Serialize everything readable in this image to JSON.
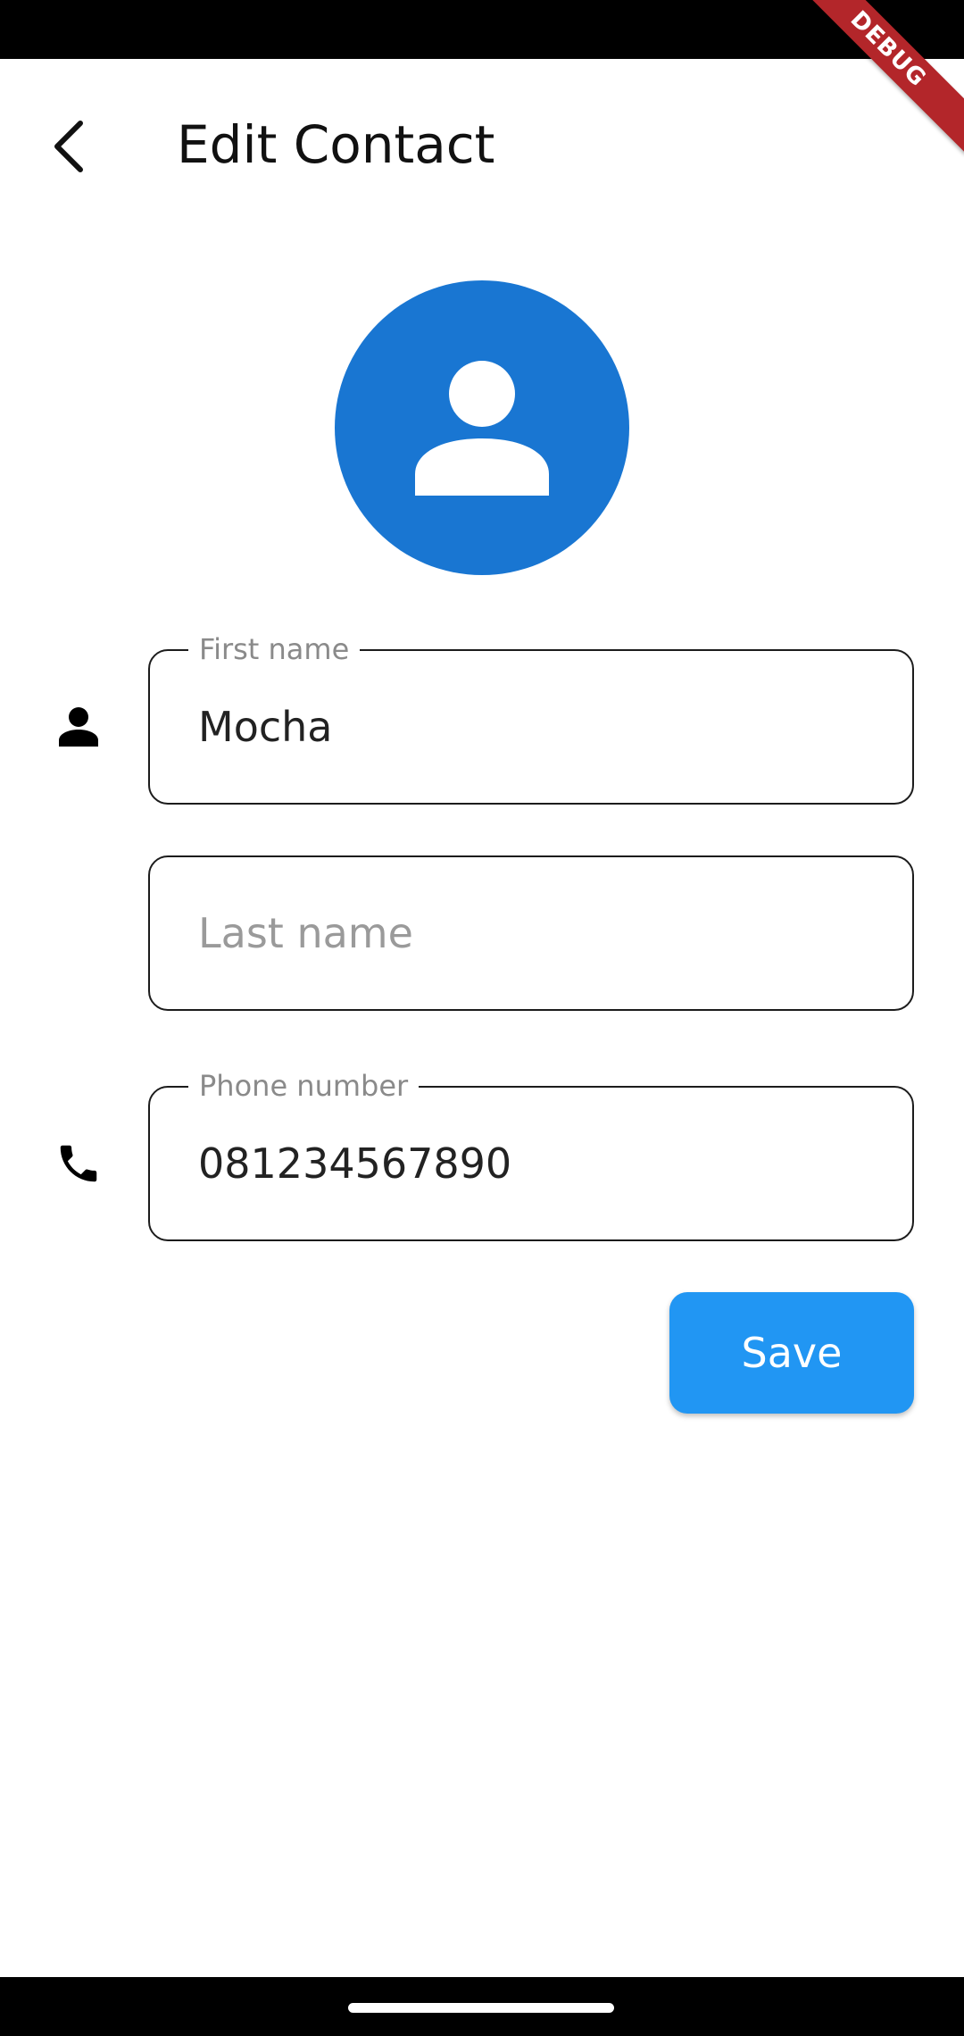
{
  "app_bar": {
    "title": "Edit Contact",
    "back_icon": "chevron-left-icon"
  },
  "debug_banner": {
    "label": "DEBUG",
    "color": "#b3262a"
  },
  "avatar": {
    "icon": "person-icon",
    "background_color": "#1976d2"
  },
  "form": {
    "first_name": {
      "label": "First name",
      "value": "Mocha",
      "icon": "person-icon"
    },
    "last_name": {
      "placeholder": "Last name",
      "value": ""
    },
    "phone": {
      "label": "Phone number",
      "value": "081234567890",
      "icon": "phone-icon"
    }
  },
  "actions": {
    "save_label": "Save",
    "save_color": "#2196f3"
  }
}
